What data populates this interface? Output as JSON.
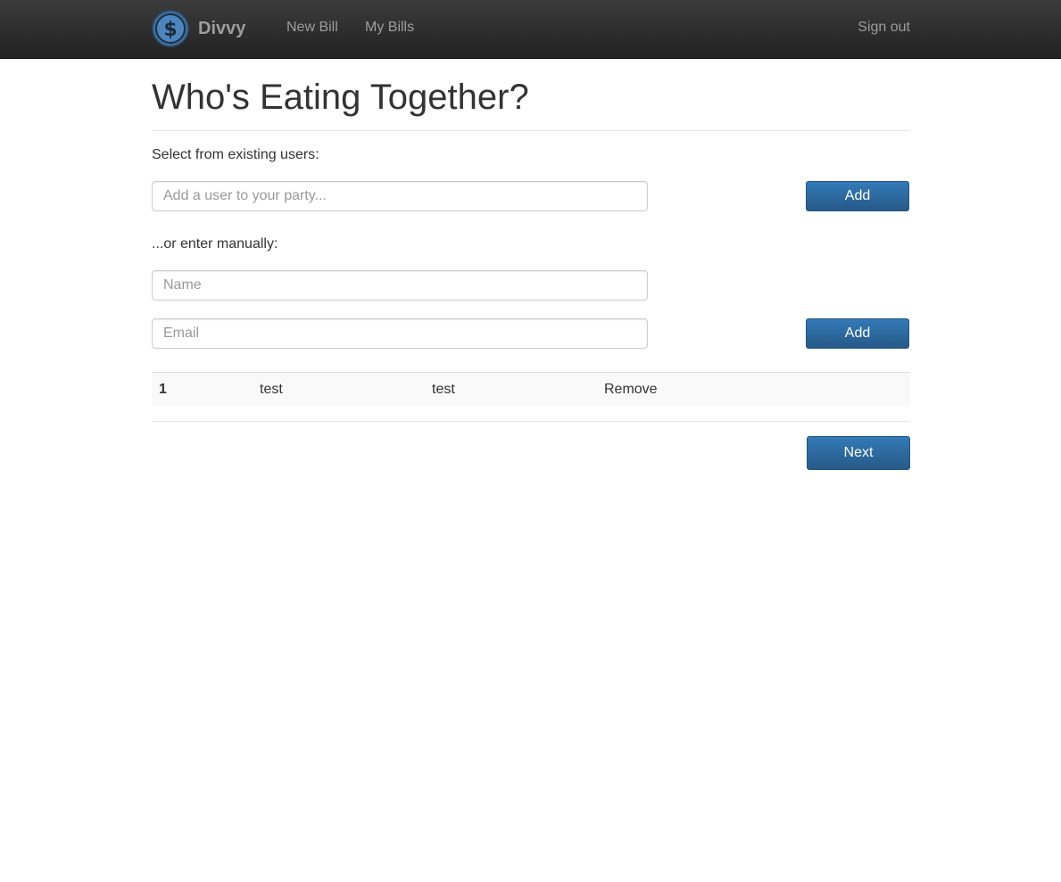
{
  "nav": {
    "brand": "Divvy",
    "links": [
      "New Bill",
      "My Bills"
    ],
    "sign_out": "Sign out"
  },
  "page": {
    "title": "Who's Eating Together?",
    "existing_label": "Select from existing users:",
    "existing_placeholder": "Add a user to your party...",
    "add_label": "Add",
    "manual_label": "...or enter manually:",
    "name_placeholder": "Name",
    "email_placeholder": "Email",
    "next_label": "Next"
  },
  "party": {
    "rows": [
      {
        "index": "1",
        "name": "test",
        "email": "test",
        "action": "Remove"
      }
    ]
  },
  "colors": {
    "navbar": "#222222",
    "primary": "#337ab7",
    "text": "#333333",
    "nav_text": "#9d9d9d"
  }
}
